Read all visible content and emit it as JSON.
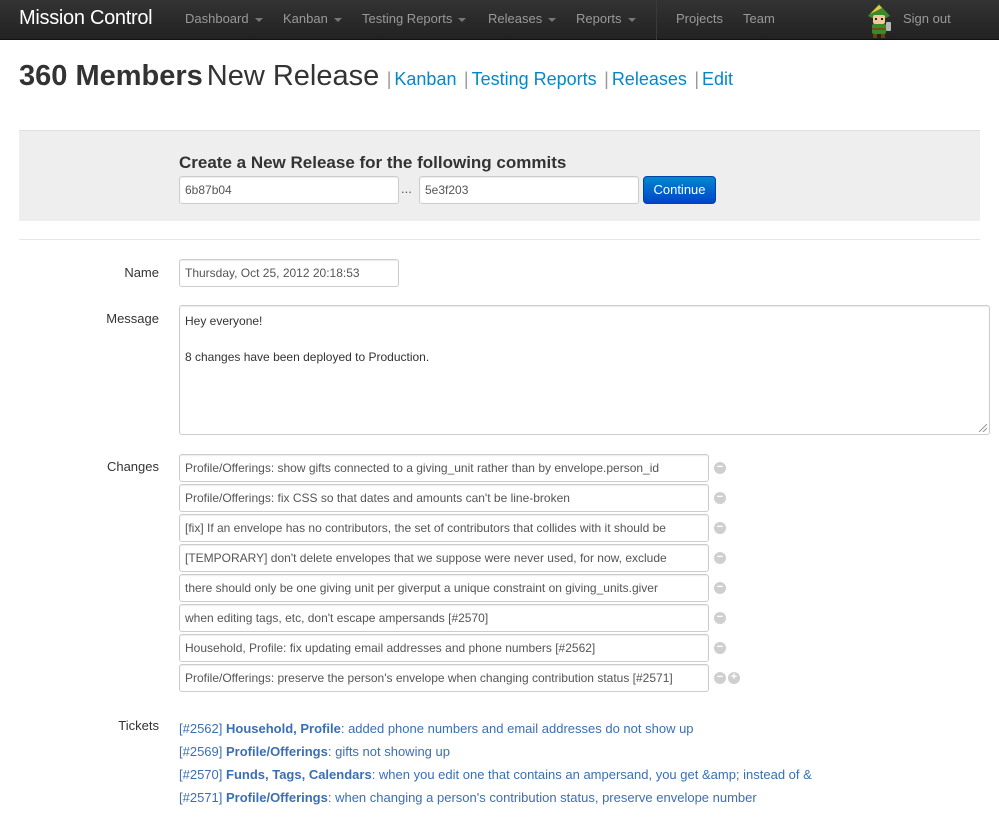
{
  "nav": {
    "brand": "Mission Control",
    "menus": [
      "Dashboard",
      "Kanban",
      "Testing Reports",
      "Releases",
      "Reports"
    ],
    "links": [
      "Projects",
      "Team"
    ],
    "signout": "Sign out"
  },
  "header": {
    "project": "360 Members",
    "page": "New Release",
    "links": [
      "Kanban",
      "Testing Reports",
      "Releases",
      "Edit"
    ]
  },
  "commits": {
    "heading": "Create a New Release for the following commits",
    "from": "6b87b04",
    "separator": "...",
    "to": "5e3f203",
    "continue_label": "Continue"
  },
  "form": {
    "name_label": "Name",
    "name_value": "Thursday, Oct 25, 2012 20:18:53",
    "message_label": "Message",
    "message_line1": "Hey everyone!",
    "message_line2": "8 changes have been deployed to Production.",
    "changes_label": "Changes",
    "changes": [
      "Profile/Offerings: show gifts connected to a giving_unit rather than by envelope.person_id",
      "Profile/Offerings: fix CSS so that dates and amounts can't be line-broken",
      "[fix] If an envelope has no contributors, the set of contributors that collides with it should be",
      "[TEMPORARY] don't delete envelopes that we suppose were never used, for now, exclude",
      "there should only be one giving unit per giverput a unique constraint on giving_units.giver",
      "when editing tags, etc, don't escape ampersands [#2570]",
      "Household, Profile: fix updating email addresses and phone numbers [#2562]",
      "Profile/Offerings: preserve the person's envelope when changing contribution status [#2571]"
    ],
    "tickets_label": "Tickets",
    "tickets": [
      {
        "id": "[#2562]",
        "project": "Household, Profile",
        "summary": ": added phone numbers and email addresses do not show up"
      },
      {
        "id": "[#2569]",
        "project": "Profile/Offerings",
        "summary": ": gifts not showing up"
      },
      {
        "id": "[#2570]",
        "project": "Funds, Tags, Calendars",
        "summary": ": when you edit one that contains an ampersand, you get &amp; instead of &"
      },
      {
        "id": "[#2571]",
        "project": "Profile/Offerings",
        "summary": ": when changing a person's contribution status, preserve envelope number"
      }
    ]
  },
  "colors": {
    "link": "#0088cc",
    "primary": "#0044cc",
    "navbar": "#222222"
  }
}
